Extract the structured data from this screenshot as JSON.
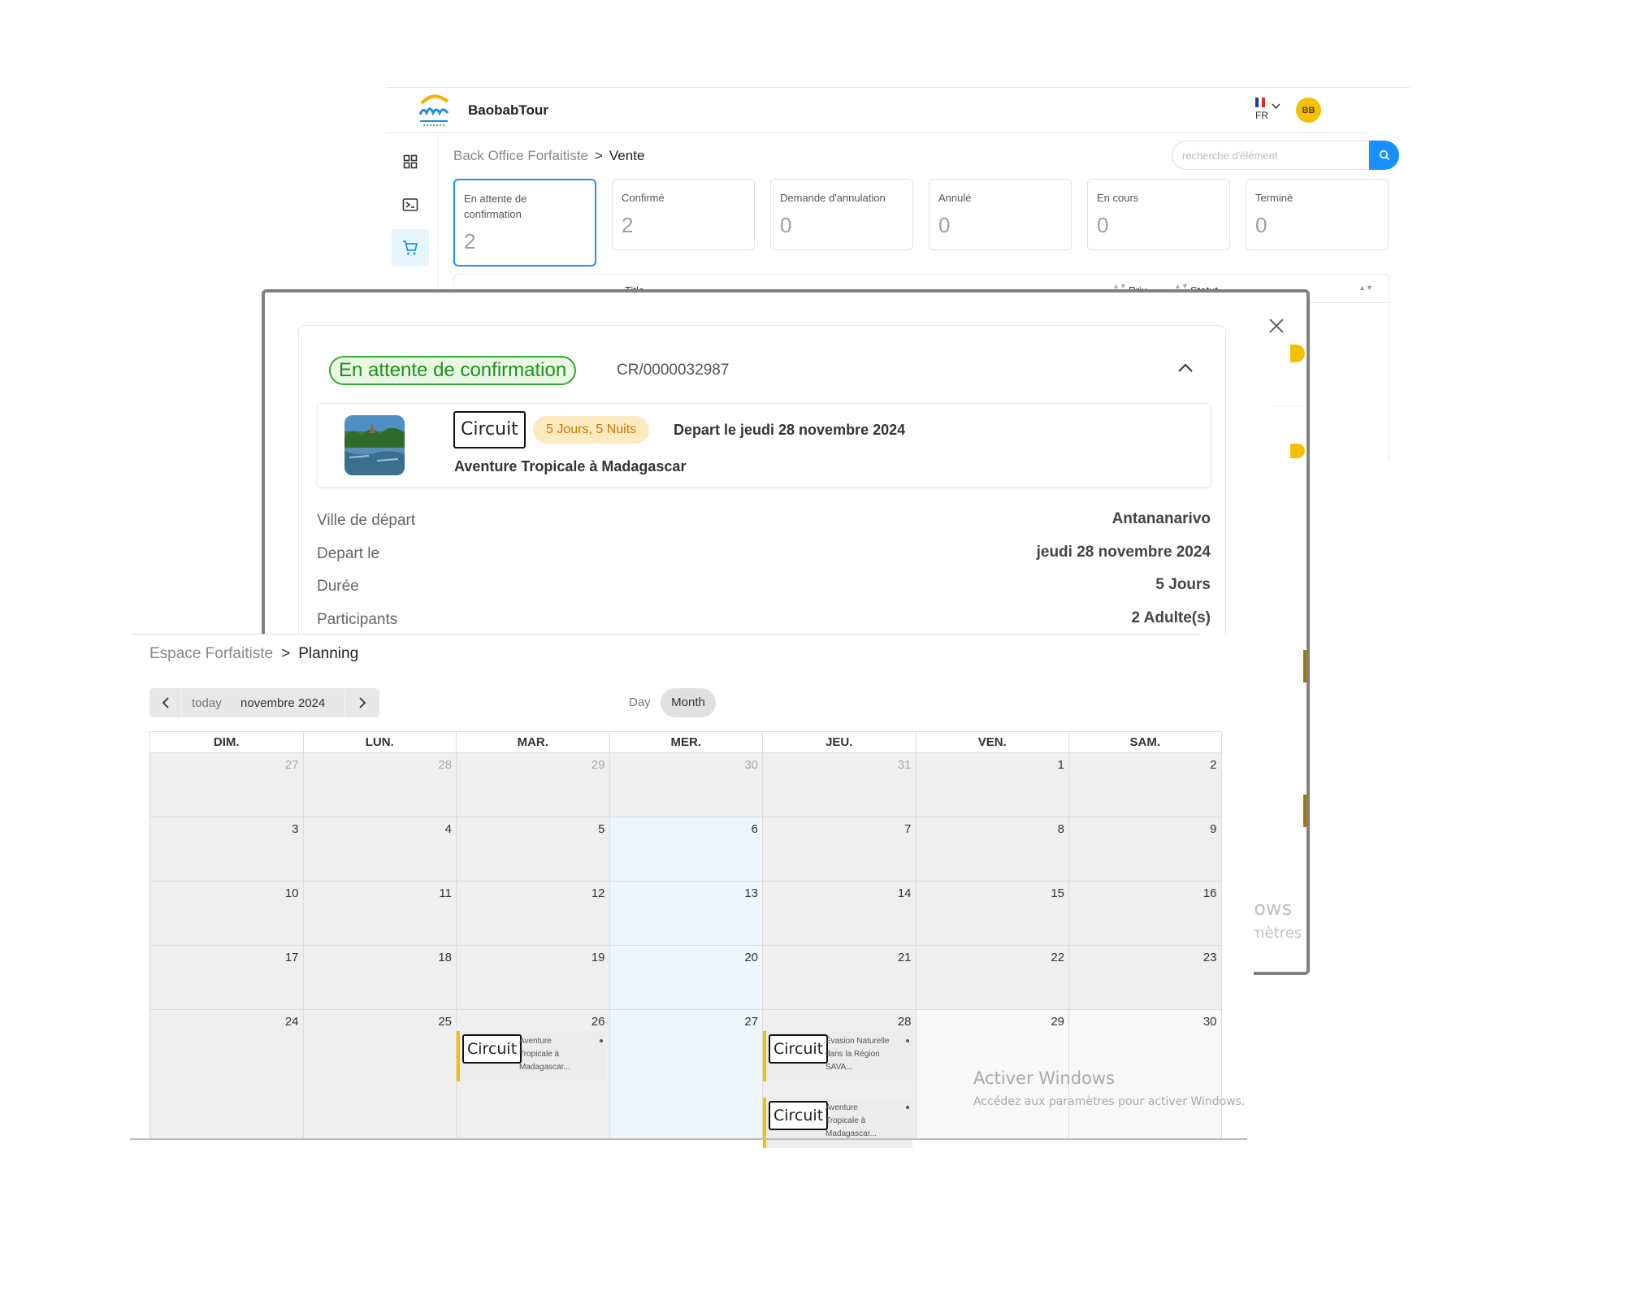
{
  "app": {
    "brand": "BaobabTour",
    "lang_code": "FR",
    "avatar_initials": "BB",
    "search_placeholder": "recherche d'élément",
    "breadcrumb": {
      "parent": "Back Office Forfaitiste",
      "separator": ">",
      "current": "Vente"
    },
    "status_cards": [
      {
        "label": "En attente de confirmation",
        "value": "2"
      },
      {
        "label": "Confirmé",
        "value": "2"
      },
      {
        "label": "Demande d'annulation",
        "value": "0"
      },
      {
        "label": "Annulé",
        "value": "0"
      },
      {
        "label": "En cours",
        "value": "0"
      },
      {
        "label": "Terminé",
        "value": "0"
      }
    ],
    "table_headers": {
      "title": "Title",
      "price": "Prix",
      "status": "Statut"
    },
    "sidebar_icons": [
      "dashboard-icon",
      "terminal-icon",
      "cart-icon"
    ],
    "colors": {
      "primary": "#1890ff",
      "avatar": "#f6c000"
    }
  },
  "reservation": {
    "status": "En attente de confirmation",
    "reference": "CR/0000032987",
    "product": {
      "category": "Circuit",
      "duration": "5 Jours, 5 Nuits",
      "depart": "Depart le jeudi 28 novembre 2024",
      "title": "Aventure Tropicale à Madagascar"
    },
    "details": [
      {
        "label": "Ville de départ",
        "value": "Antananarivo"
      },
      {
        "label": "Depart le",
        "value": "jeudi 28 novembre 2024"
      },
      {
        "label": "Durée",
        "value": "5 Jours"
      },
      {
        "label": "Participants",
        "value": "2 Adulte(s)"
      }
    ],
    "colors": {
      "status_border": "#35a735",
      "status_bg": "#e9f7e3",
      "duration_bg": "#fdeac1"
    }
  },
  "background_fragments": {
    "watermark_tail_1": "dows",
    "watermark_tail_2": "amètres"
  },
  "planning": {
    "breadcrumb": {
      "parent": "Espace Forfaitiste",
      "separator": ">",
      "current": "Planning"
    },
    "nav": {
      "today": "today",
      "month_label": "novembre 2024"
    },
    "views": {
      "day": "Day",
      "month": "Month",
      "active": "Month"
    },
    "weekdays": [
      "DIM.",
      "LUN.",
      "MAR.",
      "MER.",
      "JEU.",
      "VEN.",
      "SAM."
    ],
    "weeks": [
      [
        "27",
        "28",
        "29",
        "30",
        "31",
        "1",
        "2"
      ],
      [
        "3",
        "4",
        "5",
        "6",
        "7",
        "8",
        "9"
      ],
      [
        "10",
        "11",
        "12",
        "13",
        "14",
        "15",
        "16"
      ],
      [
        "17",
        "18",
        "19",
        "20",
        "21",
        "22",
        "23"
      ],
      [
        "24",
        "25",
        "26",
        "27",
        "28",
        "29",
        "30"
      ]
    ],
    "events": [
      {
        "day": "26",
        "category": "Circuit",
        "title": "Aventure Tropicale à Madagascar..."
      },
      {
        "day": "28",
        "category": "Circuit",
        "title": "Évasion Naturelle dans la Région SAVA..."
      },
      {
        "day": "28",
        "category": "Circuit",
        "title": "Aventure Tropicale à Madagascar..."
      }
    ],
    "colors": {
      "event_accent": "#f6c000",
      "today_column": "#eef5fd"
    }
  },
  "watermark": {
    "title": "Activer Windows",
    "subtitle": "Accédez aux paramètres pour activer Windows."
  }
}
